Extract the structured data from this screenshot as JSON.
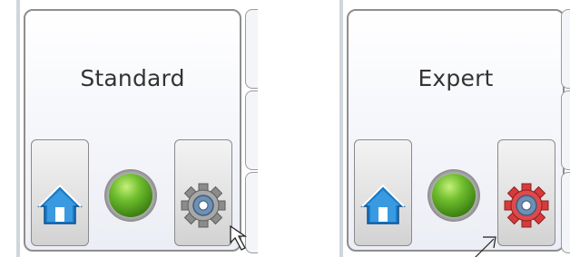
{
  "screens": [
    {
      "id": "standard",
      "title": "Standard",
      "settings_gear_color": "#6f8fb3"
    },
    {
      "id": "expert",
      "title": "Expert",
      "settings_gear_color": "#e04a4a"
    }
  ],
  "icons": {
    "home": "house-icon",
    "status": "green-status-led",
    "settings": "gear-icon",
    "pointer": "mouse-pointer"
  },
  "colors": {
    "panel_border": "#8e8e8e",
    "home_blue": "#1a7bc8",
    "led_green": "#59b329",
    "gear_grey": "#9a9a9a",
    "gear_standard_center": "#6f8fb3",
    "gear_expert_body": "#e04a4a"
  }
}
